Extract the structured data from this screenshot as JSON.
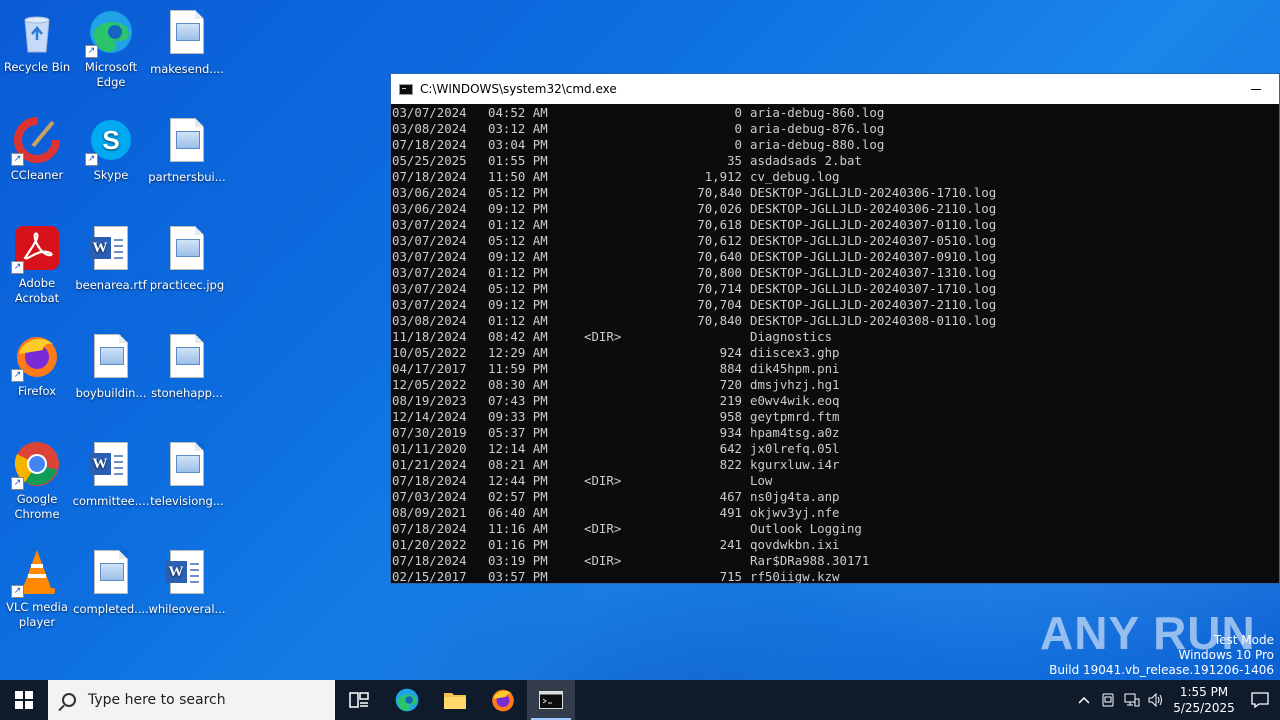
{
  "desktop": {
    "icons": [
      {
        "label": "Recycle Bin",
        "icon": "recycle-bin-icon"
      },
      {
        "label": "Microsoft Edge",
        "icon": "edge-icon"
      },
      {
        "label": "makesend....",
        "icon": "image-file-icon"
      },
      {
        "label": "CCleaner",
        "icon": "ccleaner-icon"
      },
      {
        "label": "Skype",
        "icon": "skype-icon"
      },
      {
        "label": "partnersbui...",
        "icon": "image-file-icon"
      },
      {
        "label": "Adobe Acrobat",
        "icon": "acrobat-icon"
      },
      {
        "label": "beenarea.rtf",
        "icon": "word-doc-icon"
      },
      {
        "label": "practicec.jpg",
        "icon": "image-file-icon"
      },
      {
        "label": "Firefox",
        "icon": "firefox-icon"
      },
      {
        "label": "boybuildin...",
        "icon": "image-file-icon"
      },
      {
        "label": "stonehapp...",
        "icon": "image-file-icon"
      },
      {
        "label": "Google Chrome",
        "icon": "chrome-icon"
      },
      {
        "label": "committee....",
        "icon": "word-doc-icon"
      },
      {
        "label": "televisiong...",
        "icon": "image-file-icon"
      },
      {
        "label": "VLC media player",
        "icon": "vlc-icon"
      },
      {
        "label": "completed....",
        "icon": "image-file-icon"
      },
      {
        "label": "whileoveral...",
        "icon": "word-doc-icon"
      }
    ]
  },
  "cmd": {
    "title": "C:\\WINDOWS\\system32\\cmd.exe",
    "rows": [
      {
        "date": "03/07/2024",
        "time": "04:52 AM",
        "dir": "",
        "size": "0",
        "name": "aria-debug-860.log"
      },
      {
        "date": "03/08/2024",
        "time": "03:12 AM",
        "dir": "",
        "size": "0",
        "name": "aria-debug-876.log"
      },
      {
        "date": "07/18/2024",
        "time": "03:04 PM",
        "dir": "",
        "size": "0",
        "name": "aria-debug-880.log"
      },
      {
        "date": "05/25/2025",
        "time": "01:55 PM",
        "dir": "",
        "size": "35",
        "name": "asdadsads 2.bat"
      },
      {
        "date": "07/18/2024",
        "time": "11:50 AM",
        "dir": "",
        "size": "1,912",
        "name": "cv_debug.log"
      },
      {
        "date": "03/06/2024",
        "time": "05:12 PM",
        "dir": "",
        "size": "70,840",
        "name": "DESKTOP-JGLLJLD-20240306-1710.log"
      },
      {
        "date": "03/06/2024",
        "time": "09:12 PM",
        "dir": "",
        "size": "70,026",
        "name": "DESKTOP-JGLLJLD-20240306-2110.log"
      },
      {
        "date": "03/07/2024",
        "time": "01:12 AM",
        "dir": "",
        "size": "70,618",
        "name": "DESKTOP-JGLLJLD-20240307-0110.log"
      },
      {
        "date": "03/07/2024",
        "time": "05:12 AM",
        "dir": "",
        "size": "70,612",
        "name": "DESKTOP-JGLLJLD-20240307-0510.log"
      },
      {
        "date": "03/07/2024",
        "time": "09:12 AM",
        "dir": "",
        "size": "70,640",
        "name": "DESKTOP-JGLLJLD-20240307-0910.log"
      },
      {
        "date": "03/07/2024",
        "time": "01:12 PM",
        "dir": "",
        "size": "70,800",
        "name": "DESKTOP-JGLLJLD-20240307-1310.log"
      },
      {
        "date": "03/07/2024",
        "time": "05:12 PM",
        "dir": "",
        "size": "70,714",
        "name": "DESKTOP-JGLLJLD-20240307-1710.log"
      },
      {
        "date": "03/07/2024",
        "time": "09:12 PM",
        "dir": "",
        "size": "70,704",
        "name": "DESKTOP-JGLLJLD-20240307-2110.log"
      },
      {
        "date": "03/08/2024",
        "time": "01:12 AM",
        "dir": "",
        "size": "70,840",
        "name": "DESKTOP-JGLLJLD-20240308-0110.log"
      },
      {
        "date": "11/18/2024",
        "time": "08:42 AM",
        "dir": "<DIR>",
        "size": "",
        "name": "Diagnostics"
      },
      {
        "date": "10/05/2022",
        "time": "12:29 AM",
        "dir": "",
        "size": "924",
        "name": "diiscex3.ghp"
      },
      {
        "date": "04/17/2017",
        "time": "11:59 PM",
        "dir": "",
        "size": "884",
        "name": "dik45hpm.pni"
      },
      {
        "date": "12/05/2022",
        "time": "08:30 AM",
        "dir": "",
        "size": "720",
        "name": "dmsjvhzj.hg1"
      },
      {
        "date": "08/19/2023",
        "time": "07:43 PM",
        "dir": "",
        "size": "219",
        "name": "e0wv4wik.eoq"
      },
      {
        "date": "12/14/2024",
        "time": "09:33 PM",
        "dir": "",
        "size": "958",
        "name": "geytpmrd.ftm"
      },
      {
        "date": "07/30/2019",
        "time": "05:37 PM",
        "dir": "",
        "size": "934",
        "name": "hpam4tsg.a0z"
      },
      {
        "date": "01/11/2020",
        "time": "12:14 AM",
        "dir": "",
        "size": "642",
        "name": "jx0lrefq.05l"
      },
      {
        "date": "01/21/2024",
        "time": "08:21 AM",
        "dir": "",
        "size": "822",
        "name": "kgurxluw.i4r"
      },
      {
        "date": "07/18/2024",
        "time": "12:44 PM",
        "dir": "<DIR>",
        "size": "",
        "name": "Low"
      },
      {
        "date": "07/03/2024",
        "time": "02:57 PM",
        "dir": "",
        "size": "467",
        "name": "ns0jg4ta.anp"
      },
      {
        "date": "08/09/2021",
        "time": "06:40 AM",
        "dir": "",
        "size": "491",
        "name": "okjwv3yj.nfe"
      },
      {
        "date": "07/18/2024",
        "time": "11:16 AM",
        "dir": "<DIR>",
        "size": "",
        "name": "Outlook Logging"
      },
      {
        "date": "01/20/2022",
        "time": "01:16 PM",
        "dir": "",
        "size": "241",
        "name": "qovdwkbn.ixi"
      },
      {
        "date": "07/18/2024",
        "time": "03:19 PM",
        "dir": "<DIR>",
        "size": "",
        "name": "Rar$DRa988.30171"
      },
      {
        "date": "02/15/2017",
        "time": "03:57 PM",
        "dir": "",
        "size": "715",
        "name": "rf50iigw.kzw"
      }
    ]
  },
  "watermark": {
    "brand": "ANY RUN",
    "line1": "Test Mode",
    "line2": "Windows 10 Pro",
    "line3": "Build 19041.vb_release.191206-1406"
  },
  "taskbar": {
    "search_placeholder": "Type here to search",
    "time": "1:55 PM",
    "date": "5/25/2025"
  }
}
